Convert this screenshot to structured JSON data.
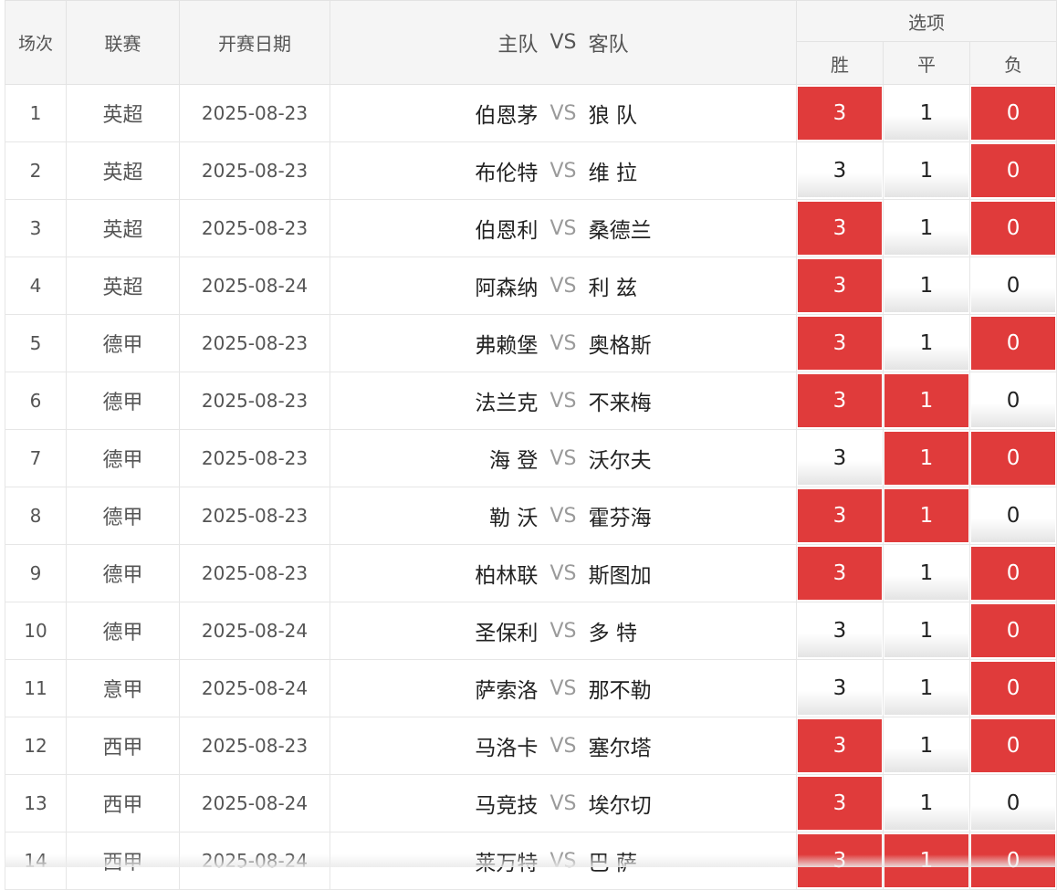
{
  "header": {
    "index": "场次",
    "league": "联赛",
    "date": "开赛日期",
    "home": "主队",
    "vs": "VS",
    "away": "客队",
    "options": "选项",
    "win": "胜",
    "draw": "平",
    "lose": "负"
  },
  "colors": {
    "selected": "#e03b3b",
    "header_bg": "#f5f5f5"
  },
  "rows": [
    {
      "index": "1",
      "league": "英超",
      "date": "2025-08-23",
      "home": "伯恩茅",
      "vs": "VS",
      "away": "狼 队",
      "win": "3",
      "draw": "1",
      "lose": "0",
      "win_sel": true,
      "draw_sel": false,
      "lose_sel": true
    },
    {
      "index": "2",
      "league": "英超",
      "date": "2025-08-23",
      "home": "布伦特",
      "vs": "VS",
      "away": "维 拉",
      "win": "3",
      "draw": "1",
      "lose": "0",
      "win_sel": false,
      "draw_sel": false,
      "lose_sel": true
    },
    {
      "index": "3",
      "league": "英超",
      "date": "2025-08-23",
      "home": "伯恩利",
      "vs": "VS",
      "away": "桑德兰",
      "win": "3",
      "draw": "1",
      "lose": "0",
      "win_sel": true,
      "draw_sel": false,
      "lose_sel": true
    },
    {
      "index": "4",
      "league": "英超",
      "date": "2025-08-24",
      "home": "阿森纳",
      "vs": "VS",
      "away": "利 兹",
      "win": "3",
      "draw": "1",
      "lose": "0",
      "win_sel": true,
      "draw_sel": false,
      "lose_sel": false
    },
    {
      "index": "5",
      "league": "德甲",
      "date": "2025-08-23",
      "home": "弗赖堡",
      "vs": "VS",
      "away": "奥格斯",
      "win": "3",
      "draw": "1",
      "lose": "0",
      "win_sel": true,
      "draw_sel": false,
      "lose_sel": true
    },
    {
      "index": "6",
      "league": "德甲",
      "date": "2025-08-23",
      "home": "法兰克",
      "vs": "VS",
      "away": "不来梅",
      "win": "3",
      "draw": "1",
      "lose": "0",
      "win_sel": true,
      "draw_sel": true,
      "lose_sel": false
    },
    {
      "index": "7",
      "league": "德甲",
      "date": "2025-08-23",
      "home": "海 登",
      "vs": "VS",
      "away": "沃尔夫",
      "win": "3",
      "draw": "1",
      "lose": "0",
      "win_sel": false,
      "draw_sel": true,
      "lose_sel": true
    },
    {
      "index": "8",
      "league": "德甲",
      "date": "2025-08-23",
      "home": "勒 沃",
      "vs": "VS",
      "away": "霍芬海",
      "win": "3",
      "draw": "1",
      "lose": "0",
      "win_sel": true,
      "draw_sel": true,
      "lose_sel": false
    },
    {
      "index": "9",
      "league": "德甲",
      "date": "2025-08-23",
      "home": "柏林联",
      "vs": "VS",
      "away": "斯图加",
      "win": "3",
      "draw": "1",
      "lose": "0",
      "win_sel": true,
      "draw_sel": false,
      "lose_sel": true
    },
    {
      "index": "10",
      "league": "德甲",
      "date": "2025-08-24",
      "home": "圣保利",
      "vs": "VS",
      "away": "多 特",
      "win": "3",
      "draw": "1",
      "lose": "0",
      "win_sel": false,
      "draw_sel": false,
      "lose_sel": true
    },
    {
      "index": "11",
      "league": "意甲",
      "date": "2025-08-24",
      "home": "萨索洛",
      "vs": "VS",
      "away": "那不勒",
      "win": "3",
      "draw": "1",
      "lose": "0",
      "win_sel": false,
      "draw_sel": false,
      "lose_sel": true
    },
    {
      "index": "12",
      "league": "西甲",
      "date": "2025-08-23",
      "home": "马洛卡",
      "vs": "VS",
      "away": "塞尔塔",
      "win": "3",
      "draw": "1",
      "lose": "0",
      "win_sel": true,
      "draw_sel": false,
      "lose_sel": true
    },
    {
      "index": "13",
      "league": "西甲",
      "date": "2025-08-24",
      "home": "马竞技",
      "vs": "VS",
      "away": "埃尔切",
      "win": "3",
      "draw": "1",
      "lose": "0",
      "win_sel": true,
      "draw_sel": false,
      "lose_sel": false
    },
    {
      "index": "14",
      "league": "西甲",
      "date": "2025-08-24",
      "home": "莱万特",
      "vs": "VS",
      "away": "巴 萨",
      "win": "3",
      "draw": "1",
      "lose": "0",
      "win_sel": true,
      "draw_sel": true,
      "lose_sel": true
    }
  ]
}
